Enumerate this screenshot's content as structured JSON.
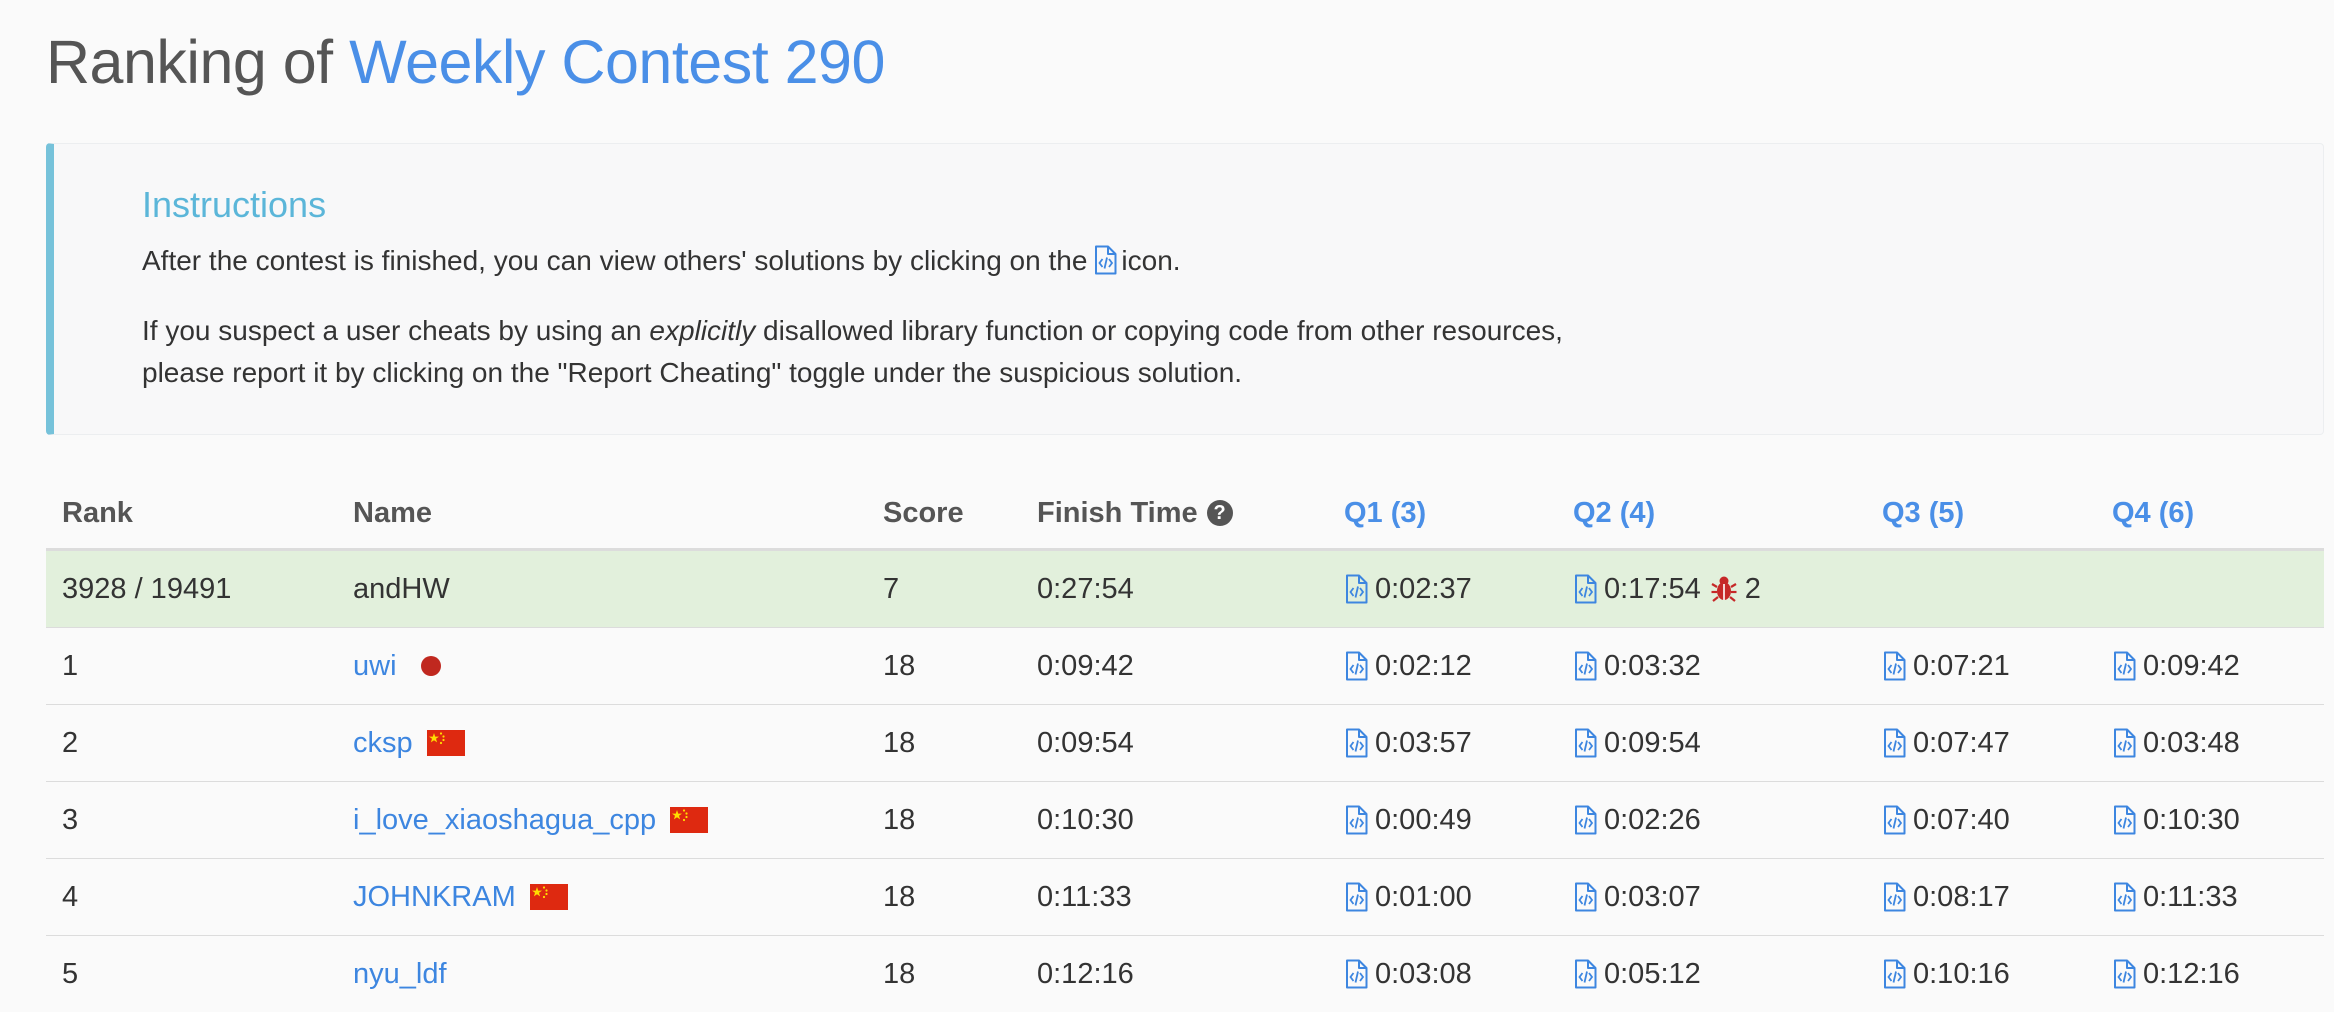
{
  "title": {
    "prefix": "Ranking of",
    "contest": "Weekly Contest 290"
  },
  "instructions": {
    "heading": "Instructions",
    "line1_before": "After the contest is finished, you can view others' solutions by clicking on the",
    "line1_after": "icon.",
    "line2_before": "If you suspect a user cheats by using an",
    "line2_em": "explicitly",
    "line2_after": "disallowed library function or copying code from other resources,",
    "line3": "please report it by clicking on the \"Report Cheating\" toggle under the suspicious solution."
  },
  "table": {
    "headers": {
      "rank": "Rank",
      "name": "Name",
      "score": "Score",
      "finish": "Finish Time",
      "q1": "Q1 (3)",
      "q2": "Q2 (4)",
      "q3": "Q3 (5)",
      "q4": "Q4 (6)"
    },
    "me": {
      "rank": "3928 / 19491",
      "name": "andHW",
      "score": "7",
      "finish": "0:27:54",
      "q1": "0:02:37",
      "q2": "0:17:54",
      "q2_wrong": "2"
    },
    "rows": [
      {
        "rank": "1",
        "name": "uwi",
        "flag": "japan",
        "score": "18",
        "finish": "0:09:42",
        "q1": "0:02:12",
        "q2": "0:03:32",
        "q3": "0:07:21",
        "q4": "0:09:42"
      },
      {
        "rank": "2",
        "name": "cksp",
        "flag": "china",
        "score": "18",
        "finish": "0:09:54",
        "q1": "0:03:57",
        "q2": "0:09:54",
        "q3": "0:07:47",
        "q4": "0:03:48"
      },
      {
        "rank": "3",
        "name": "i_love_xiaoshagua_cpp",
        "flag": "china",
        "score": "18",
        "finish": "0:10:30",
        "q1": "0:00:49",
        "q2": "0:02:26",
        "q3": "0:07:40",
        "q4": "0:10:30"
      },
      {
        "rank": "4",
        "name": "JOHNKRAM",
        "flag": "china",
        "score": "18",
        "finish": "0:11:33",
        "q1": "0:01:00",
        "q2": "0:03:07",
        "q3": "0:08:17",
        "q4": "0:11:33"
      },
      {
        "rank": "5",
        "name": "nyu_ldf",
        "flag": "",
        "score": "18",
        "finish": "0:12:16",
        "q1": "0:03:08",
        "q2": "0:05:12",
        "q3": "0:10:16",
        "q4": "0:12:16"
      }
    ]
  },
  "colors": {
    "accent": "#4a8fe7",
    "instructions_heading": "#5bb6d9",
    "instructions_border": "#76c2da",
    "my_row_bg": "#e2f0dc",
    "flag_red": "#de2910",
    "flag_yellow": "#ffde00"
  },
  "icons": {
    "solution": "code-file-icon",
    "finish_help": "question-circle-icon",
    "wrong_answer": "bug-icon"
  }
}
